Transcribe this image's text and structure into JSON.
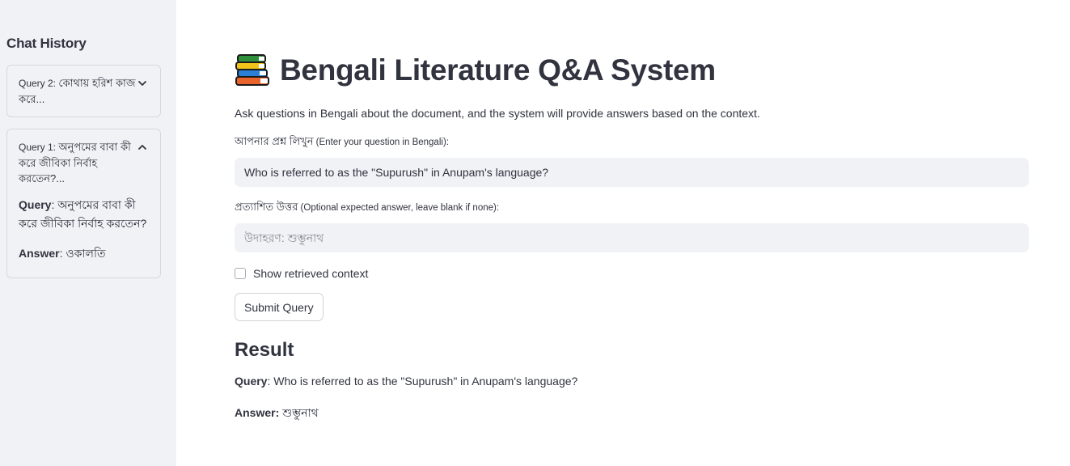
{
  "sidebar": {
    "heading": "Chat History",
    "items": [
      {
        "prefix": "Query 2: ",
        "title": "কোথায় হরিশ কাজ করে...",
        "expanded": false
      },
      {
        "prefix": "Query 1: ",
        "title": "অনুপমের বাবা কী করে জীবিকা নির্বাহ করতেন?...",
        "expanded": true,
        "query_label": "Query",
        "query_text": ": অনুপমের বাবা কী করে জীবিকা নির্বাহ করতেন?",
        "answer_label": "Answer",
        "answer_text": ": ওকালতি"
      }
    ]
  },
  "main": {
    "icon": "books-icon",
    "title": "Bengali Literature Q&A System",
    "description": "Ask questions in Bengali about the document, and the system will provide answers based on the context.",
    "question_field": {
      "label": "আপনার প্রশ্ন লিখুন",
      "hint": " (Enter your question in Bengali):",
      "value": "Who is referred to as the \"Supurush\" in Anupam's language?"
    },
    "expected_field": {
      "label": "প্রত্যাশিত উত্তর",
      "hint": " (Optional expected answer, leave blank if none):",
      "placeholder": "উদাহরণ: শুম্ভুনাথ",
      "value": ""
    },
    "checkbox": {
      "label": "Show retrieved context",
      "checked": false
    },
    "submit_label": "Submit Query",
    "result": {
      "heading": "Result",
      "query_label": "Query",
      "query_text": ": Who is referred to as the \"Supurush\" in Anupam's language?",
      "answer_label": "Answer:",
      "answer_text": " শুম্ভুনাথ"
    }
  },
  "colors": {
    "sidebar_bg": "#f0f2f6",
    "text": "#31333f",
    "input_bg": "#f0f2f6"
  }
}
